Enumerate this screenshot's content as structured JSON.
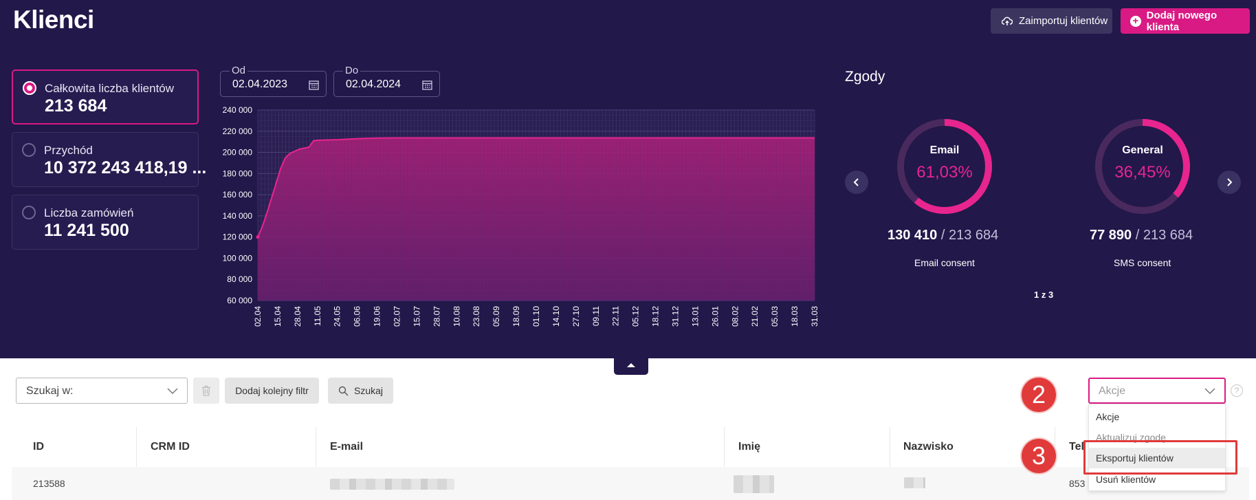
{
  "header": {
    "title": "Klienci",
    "import_label": "Zaimportuj klientów",
    "add_label": "Dodaj nowego klienta"
  },
  "stats": [
    {
      "label": "Całkowita liczba klientów",
      "value": "213 684",
      "selected": true
    },
    {
      "label": "Przychód",
      "value": "10 372 243 418,19 ...",
      "selected": false
    },
    {
      "label": "Liczba zamówień",
      "value": "11 241 500",
      "selected": false
    }
  ],
  "dates": {
    "from_label": "Od",
    "from_value": "02.04.2023",
    "to_label": "Do",
    "to_value": "02.04.2024"
  },
  "chart_data": {
    "type": "area",
    "title": "",
    "xlabel": "",
    "ylabel": "",
    "ylim": [
      60000,
      240000
    ],
    "yticks": [
      "240 000",
      "220 000",
      "200 000",
      "180 000",
      "160 000",
      "140 000",
      "120 000",
      "100 000",
      "80 000",
      "60 000"
    ],
    "xticks": [
      "02.04",
      "15.04",
      "28.04",
      "11.05",
      "24.05",
      "06.06",
      "19.06",
      "02.07",
      "15.07",
      "28.07",
      "10.08",
      "23.08",
      "05.09",
      "18.09",
      "01.10",
      "14.10",
      "27.10",
      "09.11",
      "22.11",
      "05.12",
      "18.12",
      "31.12",
      "13.01",
      "26.01",
      "08.02",
      "21.02",
      "05.03",
      "18.03",
      "31.03"
    ],
    "grid": true,
    "color": "#e8258f",
    "series": [
      {
        "x": [
          "02.04",
          "05.04",
          "08.04",
          "11.04",
          "14.04",
          "17.04",
          "20.04",
          "23.04",
          "26.04",
          "29.04",
          "02.05",
          "05.05",
          "08.05",
          "11.05",
          "24.05",
          "06.06",
          "19.06",
          "02.07",
          "31.03"
        ],
        "values": [
          120000,
          130000,
          143000,
          157000,
          171000,
          185000,
          195000,
          199000,
          201000,
          203000,
          204000,
          205000,
          211000,
          211500,
          212000,
          213000,
          213500,
          213684,
          213684
        ]
      }
    ]
  },
  "consents": {
    "title": "Zgody",
    "pager": "1 z 3",
    "items": [
      {
        "name": "Email",
        "percent": "61,03%",
        "fraction": 0.6103,
        "count": "130 410",
        "total": "/ 213 684",
        "caption": "Email consent"
      },
      {
        "name": "General",
        "percent": "36,45%",
        "fraction": 0.3645,
        "count": "77 890",
        "total": "/ 213 684",
        "caption": "SMS consent"
      }
    ]
  },
  "filters": {
    "search_label": "Szukaj w:",
    "add_filter_label": "Dodaj kolejny filtr",
    "search_button_label": "Szukaj"
  },
  "actions": {
    "placeholder": "Akcje",
    "options": [
      "Akcje",
      "Aktualizuj zgodę",
      "Eksportuj klientów",
      "Usuń klientów"
    ],
    "help": "?"
  },
  "steps": [
    "2",
    "3"
  ],
  "table": {
    "columns": [
      "ID",
      "CRM ID",
      "E-mail",
      "Imię",
      "Nazwisko",
      "Tel"
    ],
    "rows": [
      {
        "id": "213588",
        "crm_id": "",
        "phone_partial": "853"
      }
    ]
  },
  "colors": {
    "hero_bg": "#22184a",
    "accent": "#d91a84",
    "annotation_red": "#e03a3a"
  }
}
